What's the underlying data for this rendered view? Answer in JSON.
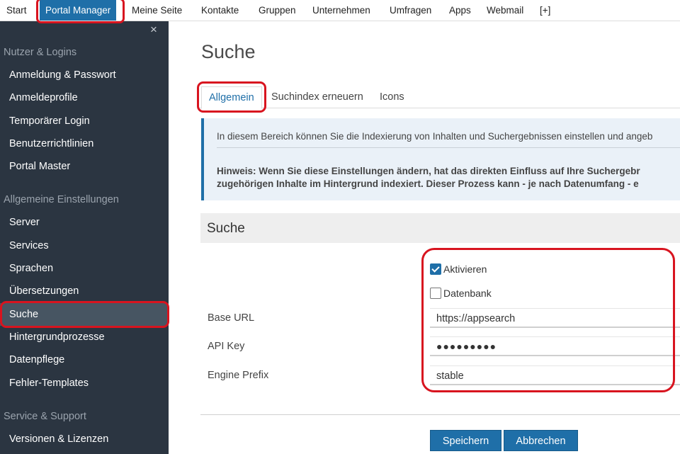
{
  "topnav": {
    "items": [
      "Start",
      "Portal Manager",
      "Meine Seite",
      "Kontakte",
      "Gruppen",
      "Unternehmen",
      "Umfragen",
      "Apps",
      "Webmail",
      "[+]"
    ],
    "active": "Portal Manager"
  },
  "sidebar": {
    "close_icon": "×",
    "sections": [
      {
        "title": "Nutzer & Logins",
        "items": [
          "Anmeldung & Passwort",
          "Anmeldeprofile",
          "Temporärer Login",
          "Benutzerrichtlinien",
          "Portal Master"
        ]
      },
      {
        "title": "Allgemeine Einstellungen",
        "items": [
          "Server",
          "Services",
          "Sprachen",
          "Übersetzungen",
          "Suche",
          "Hintergrundprozesse",
          "Datenpflege",
          "Fehler-Templates"
        ]
      },
      {
        "title": "Service & Support",
        "items": [
          "Versionen & Lizenzen"
        ]
      }
    ],
    "selected": "Suche"
  },
  "main": {
    "title": "Suche",
    "tabs": [
      "Allgemein",
      "Suchindex erneuern",
      "Icons"
    ],
    "active_tab": "Allgemein",
    "info_text": "In diesem Bereich können Sie die Indexierung von Inhalten und Suchergebnissen einstellen und angeb",
    "note_line1": "Hinweis: Wenn Sie diese Einstellungen ändern, hat das direkten Einfluss auf Ihre Suchergebr",
    "note_line2": "zugehörigen Inhalte im Hintergrund indexiert. Dieser Prozess kann - je nach Datenumfang - e",
    "panel_title": "Suche",
    "checkboxes": [
      {
        "label": "Aktivieren",
        "checked": true
      },
      {
        "label": "Datenbank",
        "checked": false
      }
    ],
    "fields": [
      {
        "label": "Base URL",
        "value": "https://appsearch"
      },
      {
        "label": "API Key",
        "value": "●●●●●●●●●"
      },
      {
        "label": "Engine Prefix",
        "value": "stable"
      }
    ],
    "buttons": {
      "save": "Speichern",
      "cancel": "Abbrechen"
    }
  },
  "colors": {
    "accent": "#1f6fa8",
    "sidebar_bg": "#2b3541",
    "highlight": "#d8141f"
  }
}
